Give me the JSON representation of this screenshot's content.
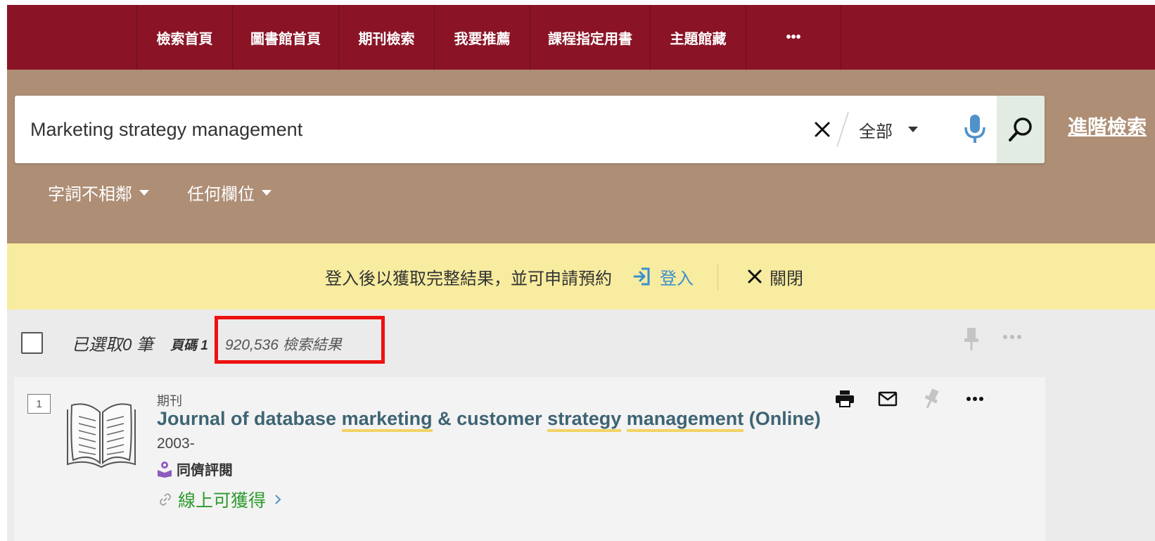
{
  "nav": {
    "items": [
      {
        "label": "檢索首頁"
      },
      {
        "label": "圖書館首頁"
      },
      {
        "label": "期刊檢索"
      },
      {
        "label": "我要推薦"
      },
      {
        "label": "課程指定用書"
      },
      {
        "label": "主題館藏"
      }
    ],
    "more_label": "•••"
  },
  "search": {
    "query": "Marketing strategy management",
    "scope": "全部",
    "advanced_label": "進階檢索",
    "filters": [
      {
        "label": "字詞不相鄰"
      },
      {
        "label": "任何欄位"
      }
    ]
  },
  "banner": {
    "message": "登入後以獲取完整結果，並可申請預約",
    "login_label": "登入",
    "close_label": "關閉"
  },
  "results": {
    "selected": "已選取0 筆",
    "page": "頁碼 1",
    "count": "920,536 檢索結果",
    "more_label": "•••"
  },
  "record": {
    "number": "1",
    "type": "期刊",
    "title_parts": [
      {
        "text": "Journal of database ",
        "hl": false
      },
      {
        "text": "marketing",
        "hl": true
      },
      {
        "text": " & customer ",
        "hl": false
      },
      {
        "text": "strategy",
        "hl": true
      },
      {
        "text": " ",
        "hl": false
      },
      {
        "text": "management",
        "hl": true
      },
      {
        "text": " (Online)",
        "hl": false
      }
    ],
    "year": "2003-",
    "peer_reviewed": "同儕評閱",
    "availability": "線上可獲得",
    "more_label": "•••"
  },
  "colors": {
    "nav_bg": "#8a1426",
    "search_band_bg": "#ae8e75",
    "banner_bg": "#f7ec9f",
    "title": "#3e6474",
    "highlight_underline": "#f2d463",
    "available_green": "#2f9a2f",
    "link_blue": "#3a8fd0",
    "annotation_red": "#ee1111"
  },
  "icons": {
    "clear": "close-icon",
    "scope_dropdown": "caret-down-icon",
    "voice": "microphone-icon",
    "search": "search-icon",
    "login": "sign-in-icon",
    "close": "close-icon",
    "pin": "pin-icon",
    "more": "more-icon",
    "print": "print-icon",
    "email": "mail-icon",
    "record_type": "open-book-icon",
    "peer_review": "peer-review-icon",
    "link": "link-icon",
    "chevron": "chevron-right-icon"
  }
}
